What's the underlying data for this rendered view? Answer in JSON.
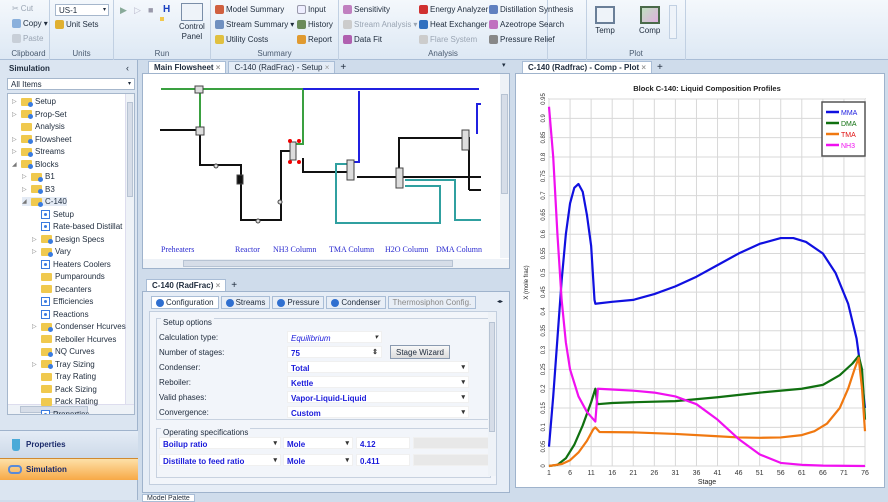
{
  "ribbon": {
    "clipboard": {
      "label": "Clipboard",
      "cut": "Cut",
      "copy": "Copy",
      "paste": "Paste"
    },
    "units": {
      "label": "Units",
      "select": "US-1",
      "unit_sets": "Unit Sets"
    },
    "run": {
      "label": "Run",
      "control_panel_1": "Control",
      "control_panel_2": "Panel"
    },
    "summary": {
      "label": "Summary",
      "model_summary": "Model Summary",
      "stream_summary": "Stream Summary",
      "utility_costs": "Utility Costs",
      "input": "Input",
      "history": "History",
      "report": "Report"
    },
    "analysis": {
      "label": "Analysis",
      "sensitivity": "Sensitivity",
      "stream_analysis": "Stream Analysis",
      "data_fit": "Data Fit",
      "energy_analyzer": "Energy Analyzer",
      "heat_exchanger": "Heat Exchanger",
      "flare_system": "Flare System",
      "distillation_synthesis": "Distillation Synthesis",
      "azeotrope_search": "Azeotrope Search",
      "pressure_relief": "Pressure Relief"
    },
    "plot": {
      "label": "Plot",
      "temp": "Temp",
      "comp": "Comp"
    }
  },
  "nav": {
    "title": "Simulation",
    "filter": "All Items",
    "tree": [
      {
        "label": "Setup",
        "level": 0,
        "icon": "folder-b",
        "exp": "closed"
      },
      {
        "label": "Prop-Set",
        "level": 0,
        "icon": "folder-b",
        "exp": "closed"
      },
      {
        "label": "Analysis",
        "level": 0,
        "icon": "folder",
        "exp": ""
      },
      {
        "label": "Flowsheet",
        "level": 0,
        "icon": "folder-b",
        "exp": "closed"
      },
      {
        "label": "Streams",
        "level": 0,
        "icon": "folder-b",
        "exp": "closed"
      },
      {
        "label": "Blocks",
        "level": 0,
        "icon": "folder-b",
        "exp": "open"
      },
      {
        "label": "B1",
        "level": 1,
        "icon": "folder-b",
        "exp": "closed"
      },
      {
        "label": "B3",
        "level": 1,
        "icon": "folder-b",
        "exp": "closed"
      },
      {
        "label": "C-140",
        "level": 1,
        "icon": "folder-b",
        "exp": "open"
      },
      {
        "label": "Setup",
        "level": 2,
        "icon": "form",
        "exp": ""
      },
      {
        "label": "Rate-based Distillat",
        "level": 2,
        "icon": "form",
        "exp": ""
      },
      {
        "label": "Design Specs",
        "level": 2,
        "icon": "folder-b",
        "exp": "closed"
      },
      {
        "label": "Vary",
        "level": 2,
        "icon": "folder-b",
        "exp": "closed"
      },
      {
        "label": "Heaters Coolers",
        "level": 2,
        "icon": "form",
        "exp": ""
      },
      {
        "label": "Pumparounds",
        "level": 2,
        "icon": "folder",
        "exp": ""
      },
      {
        "label": "Decanters",
        "level": 2,
        "icon": "folder",
        "exp": ""
      },
      {
        "label": "Efficiencies",
        "level": 2,
        "icon": "form",
        "exp": ""
      },
      {
        "label": "Reactions",
        "level": 2,
        "icon": "form",
        "exp": ""
      },
      {
        "label": "Condenser Hcurves",
        "level": 2,
        "icon": "folder-b",
        "exp": "closed"
      },
      {
        "label": "Reboiler Hcurves",
        "level": 2,
        "icon": "folder",
        "exp": ""
      },
      {
        "label": "NQ Curves",
        "level": 2,
        "icon": "folder-b",
        "exp": ""
      },
      {
        "label": "Tray Sizing",
        "level": 2,
        "icon": "folder-b",
        "exp": "closed"
      },
      {
        "label": "Tray Rating",
        "level": 2,
        "icon": "folder",
        "exp": ""
      },
      {
        "label": "Pack Sizing",
        "level": 2,
        "icon": "folder",
        "exp": ""
      },
      {
        "label": "Pack Rating",
        "level": 2,
        "icon": "folder",
        "exp": ""
      },
      {
        "label": "Properties",
        "level": 2,
        "icon": "form",
        "exp": ""
      }
    ],
    "bottom": {
      "properties": "Properties",
      "simulation": "Simulation"
    }
  },
  "tabs": {
    "main_flowsheet": "Main Flowsheet",
    "c140_setup": "C-140 (RadFrac) - Setup",
    "c140_radfrac": "C-140 (RadFrac)",
    "comp_plot": "C-140 (Radfrac) - Comp - Plot",
    "model_palette": "Model Palette"
  },
  "flowsheet": {
    "labels": [
      "Preheaters",
      "Reactor",
      "NH3 Column",
      "TMA Column",
      "H2O Column",
      "DMA Column"
    ]
  },
  "setup": {
    "tabs": [
      "Configuration",
      "Streams",
      "Pressure",
      "Condenser",
      "Thermosiphon Config."
    ],
    "setup_options": "Setup options",
    "calc_type_label": "Calculation type:",
    "calc_type": "Equilibrium",
    "stages_label": "Number of stages:",
    "stages": "75",
    "stage_wizard": "Stage Wizard",
    "condenser_label": "Condenser:",
    "condenser": "Total",
    "reboiler_label": "Reboiler:",
    "reboiler": "Kettle",
    "phases_label": "Valid phases:",
    "phases": "Vapor-Liquid-Liquid",
    "convergence_label": "Convergence:",
    "convergence": "Custom",
    "op_specs": "Operating specifications",
    "specs": [
      {
        "name": "Boilup ratio",
        "basis": "Mole",
        "value": "4.12"
      },
      {
        "name": "Distillate to feed ratio",
        "basis": "Mole",
        "value": "0.411"
      }
    ]
  },
  "chart_data": {
    "type": "line",
    "title": "Block C-140: Liquid Composition Profiles",
    "xlabel": "Stage",
    "ylabel": "X (mole frac)",
    "xlim": [
      1,
      76
    ],
    "ylim": [
      0,
      0.95
    ],
    "xticks": [
      1,
      6,
      11,
      16,
      21,
      26,
      31,
      36,
      41,
      46,
      51,
      56,
      61,
      66,
      71,
      76
    ],
    "yticks": [
      0,
      0.05,
      0.1,
      0.15,
      0.2,
      0.25,
      0.3,
      0.35,
      0.4,
      0.45,
      0.5,
      0.55,
      0.6,
      0.65,
      0.7,
      0.75,
      0.8,
      0.85,
      0.9,
      0.95
    ],
    "legend": "top-right",
    "grid": true,
    "series": [
      {
        "name": "MMA",
        "color": "#1010e0",
        "points": [
          [
            1,
            0.05
          ],
          [
            2,
            0.18
          ],
          [
            3,
            0.33
          ],
          [
            4,
            0.48
          ],
          [
            5,
            0.6
          ],
          [
            6,
            0.68
          ],
          [
            7,
            0.72
          ],
          [
            8,
            0.73
          ],
          [
            9,
            0.71
          ],
          [
            10,
            0.65
          ],
          [
            11,
            0.57
          ],
          [
            11.8,
            0.43
          ],
          [
            12,
            0.42
          ],
          [
            16,
            0.425
          ],
          [
            21,
            0.43
          ],
          [
            26,
            0.445
          ],
          [
            31,
            0.465
          ],
          [
            36,
            0.49
          ],
          [
            41,
            0.52
          ],
          [
            46,
            0.55
          ],
          [
            51,
            0.575
          ],
          [
            56,
            0.59
          ],
          [
            59,
            0.59
          ],
          [
            62,
            0.58
          ],
          [
            66,
            0.55
          ],
          [
            69,
            0.5
          ],
          [
            72,
            0.42
          ],
          [
            74,
            0.33
          ],
          [
            75,
            0.25
          ],
          [
            76,
            0.15
          ]
        ]
      },
      {
        "name": "DMA",
        "color": "#107010",
        "points": [
          [
            1,
            0
          ],
          [
            3,
            0.003
          ],
          [
            5,
            0.02
          ],
          [
            7,
            0.055
          ],
          [
            9,
            0.105
          ],
          [
            11,
            0.165
          ],
          [
            12,
            0.2
          ],
          [
            12.5,
            0.16
          ],
          [
            16,
            0.163
          ],
          [
            21,
            0.165
          ],
          [
            31,
            0.168
          ],
          [
            41,
            0.178
          ],
          [
            51,
            0.19
          ],
          [
            61,
            0.2
          ],
          [
            66,
            0.21
          ],
          [
            70,
            0.235
          ],
          [
            73,
            0.265
          ],
          [
            74.5,
            0.285
          ],
          [
            75.3,
            0.25
          ],
          [
            76,
            0.12
          ]
        ]
      },
      {
        "name": "TMA",
        "color": "#f07810",
        "points": [
          [
            1,
            0
          ],
          [
            4,
            0.005
          ],
          [
            6,
            0.015
          ],
          [
            8,
            0.035
          ],
          [
            10,
            0.065
          ],
          [
            11.5,
            0.095
          ],
          [
            12,
            0.1
          ],
          [
            13,
            0.088
          ],
          [
            21,
            0.087
          ],
          [
            31,
            0.083
          ],
          [
            41,
            0.077
          ],
          [
            46,
            0.074
          ],
          [
            51,
            0.073
          ],
          [
            56,
            0.074
          ],
          [
            61,
            0.08
          ],
          [
            64,
            0.09
          ],
          [
            67,
            0.11
          ],
          [
            70,
            0.15
          ],
          [
            72,
            0.2
          ],
          [
            73.5,
            0.25
          ],
          [
            74.5,
            0.28
          ],
          [
            75.3,
            0.2
          ],
          [
            76,
            0.09
          ]
        ]
      },
      {
        "name": "NH3",
        "color": "#f010f0",
        "points": [
          [
            1,
            0.93
          ],
          [
            2,
            0.8
          ],
          [
            3,
            0.6
          ],
          [
            4,
            0.43
          ],
          [
            5,
            0.32
          ],
          [
            6,
            0.25
          ],
          [
            8,
            0.18
          ],
          [
            10,
            0.14
          ],
          [
            12,
            0.115
          ],
          [
            12.6,
            0.2
          ],
          [
            16,
            0.198
          ],
          [
            21,
            0.195
          ],
          [
            26,
            0.19
          ],
          [
            31,
            0.18
          ],
          [
            36,
            0.16
          ],
          [
            41,
            0.12
          ],
          [
            46,
            0.07
          ],
          [
            51,
            0.03
          ],
          [
            56,
            0.008
          ],
          [
            61,
            0.003
          ],
          [
            66,
            0.001
          ],
          [
            76,
            0
          ]
        ]
      }
    ]
  }
}
